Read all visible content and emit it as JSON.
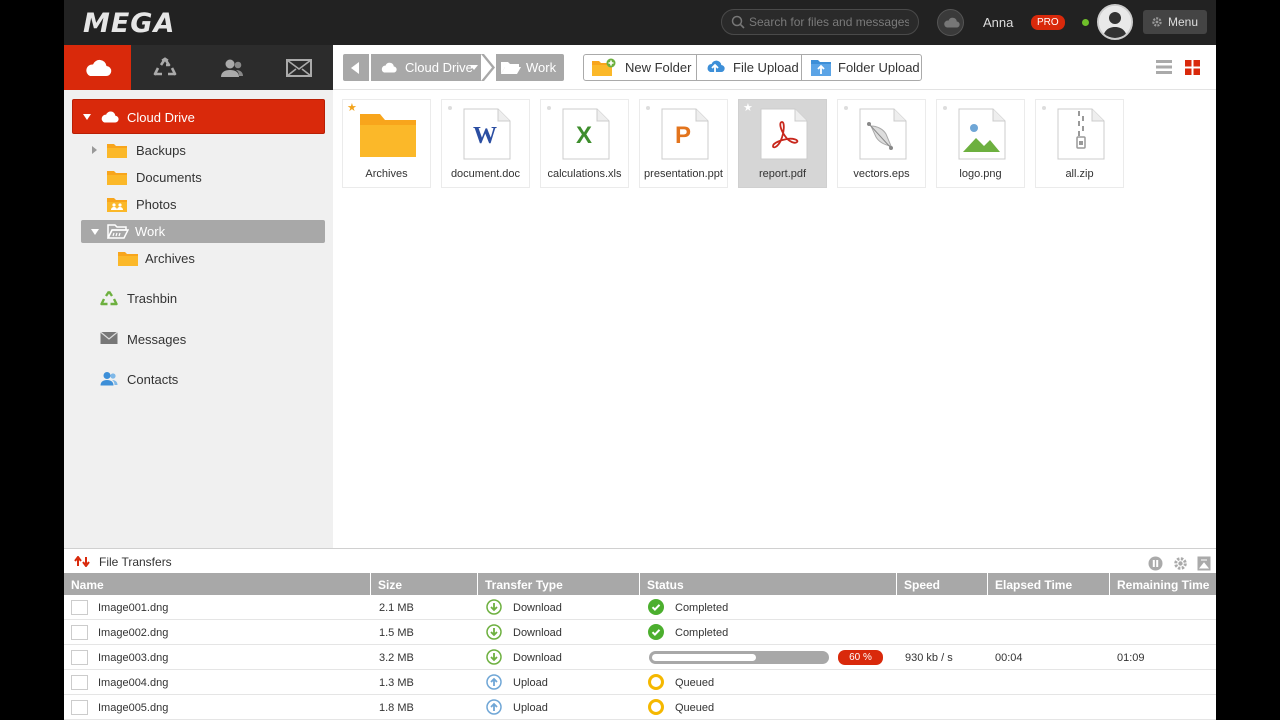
{
  "brand": {
    "logo": "MEGA",
    "accent": "#d9290b"
  },
  "topbar": {
    "search_placeholder": "Search for files and messages",
    "user_name": "Anna",
    "plan_badge": "PRO",
    "menu_label": "Menu"
  },
  "nav_tabs": [
    "cloud-drive-icon",
    "recycle-icon",
    "contacts-icon",
    "envelope-icon"
  ],
  "sidebar": {
    "root": "Cloud Drive",
    "tree": [
      "Backups",
      "Documents",
      "Photos",
      "Work",
      "Archives"
    ],
    "links": [
      "Trashbin",
      "Messages",
      "Contacts"
    ]
  },
  "toolbar": {
    "breadcrumb": [
      "Cloud Drive",
      "Work"
    ],
    "new_folder": "New Folder",
    "file_upload": "File Upload",
    "folder_upload": "Folder Upload"
  },
  "files": [
    {
      "name": "Archives",
      "type": "folder",
      "starred": true
    },
    {
      "name": "document.doc",
      "type": "doc",
      "letter": "W",
      "color": "#2b4ea2"
    },
    {
      "name": "calculations.xls",
      "type": "xls",
      "letter": "X",
      "color": "#3e8e2d"
    },
    {
      "name": "presentation.ppt",
      "type": "ppt",
      "letter": "P",
      "color": "#e3741d"
    },
    {
      "name": "report.pdf",
      "type": "pdf",
      "starred": true,
      "selected": true
    },
    {
      "name": "vectors.eps",
      "type": "eps"
    },
    {
      "name": "logo.png",
      "type": "png"
    },
    {
      "name": "all.zip",
      "type": "zip"
    }
  ],
  "transfers": {
    "title": "File Transfers",
    "columns": [
      "Name",
      "Size",
      "Transfer Type",
      "Status",
      "Speed",
      "Elapsed Time",
      "Remaining Time"
    ],
    "rows": [
      {
        "name": "Image001.dng",
        "size": "2.1 MB",
        "type": "Download",
        "status": "Completed",
        "speed": "",
        "elapsed": "",
        "remaining": ""
      },
      {
        "name": "Image002.dng",
        "size": "1.5 MB",
        "type": "Download",
        "status": "Completed",
        "speed": "",
        "elapsed": "",
        "remaining": ""
      },
      {
        "name": "Image003.dng",
        "size": "3.2 MB",
        "type": "Download",
        "status": "",
        "progress_percent": 60,
        "progress_label": "60 %",
        "speed": "930 kb / s",
        "elapsed": "00:04",
        "remaining": "01:09"
      },
      {
        "name": "Image004.dng",
        "size": "1.3 MB",
        "type": "Upload",
        "status": "Queued",
        "speed": "",
        "elapsed": "",
        "remaining": ""
      },
      {
        "name": "Image005.dng",
        "size": "1.8 MB",
        "type": "Upload",
        "status": "Queued",
        "speed": "",
        "elapsed": "",
        "remaining": ""
      }
    ]
  }
}
